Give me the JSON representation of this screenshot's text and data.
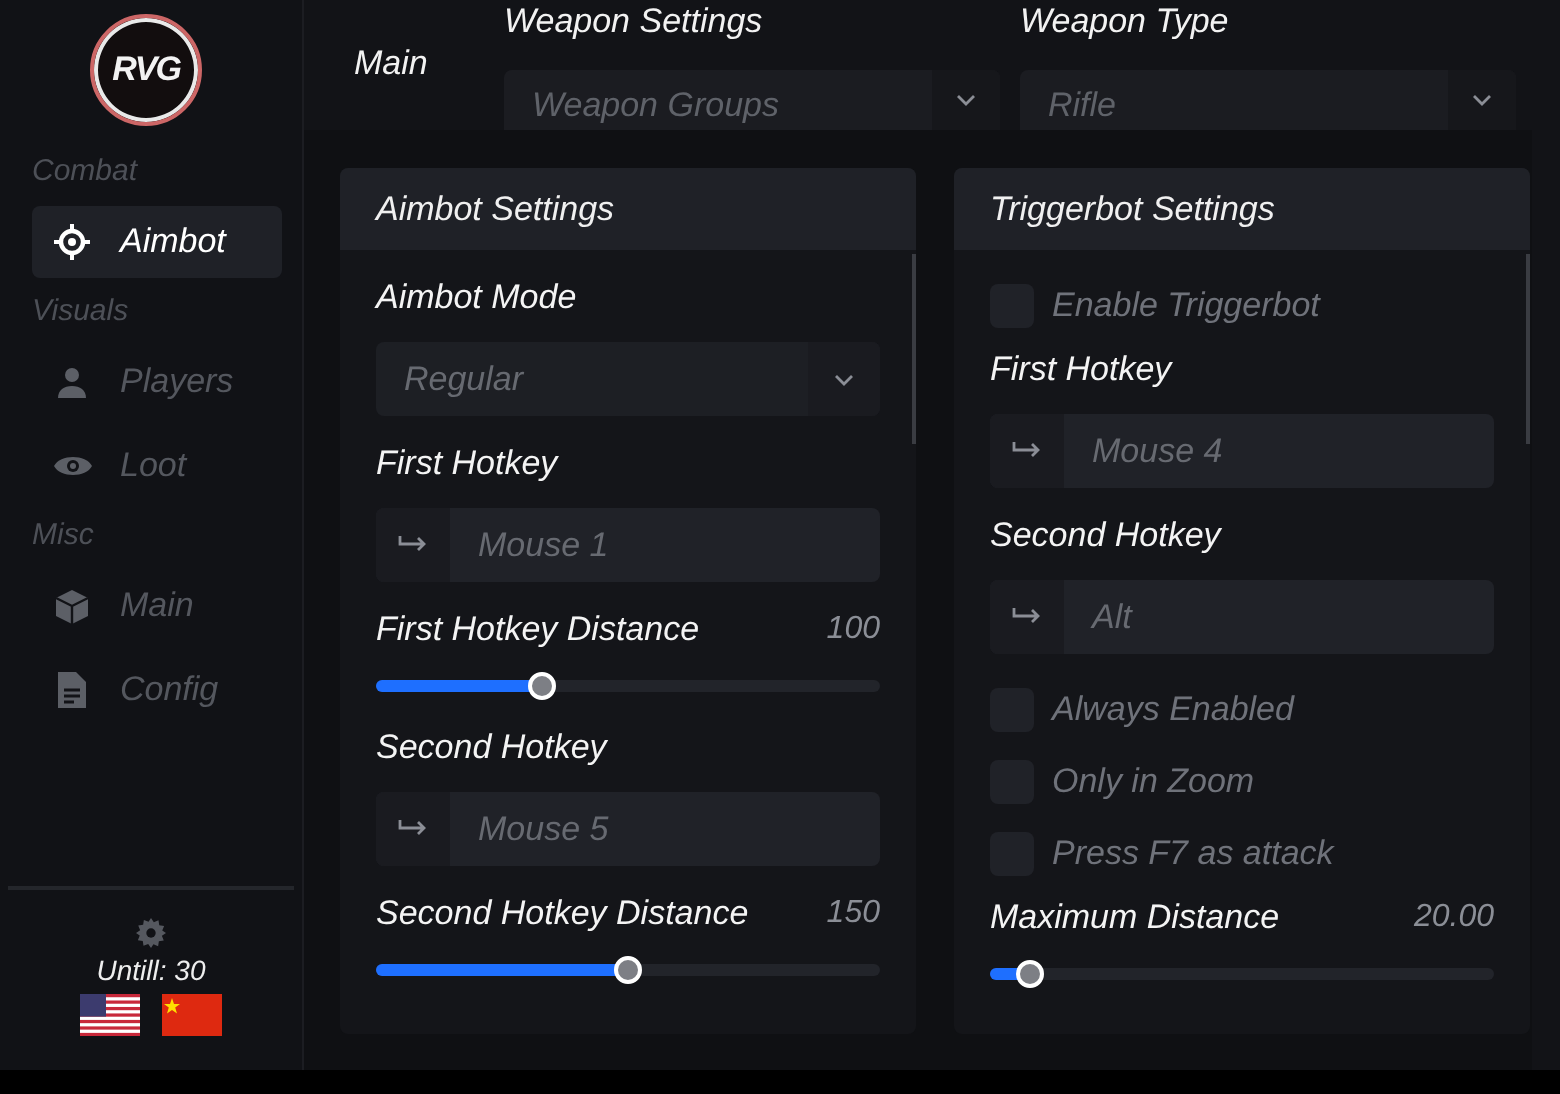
{
  "logo": {
    "text": "RVG"
  },
  "sidebar": {
    "sections": [
      {
        "title": "Combat",
        "items": [
          {
            "label": "Aimbot",
            "kind": "crosshair",
            "selected": true
          }
        ]
      },
      {
        "title": "Visuals",
        "items": [
          {
            "label": "Players",
            "kind": "person",
            "selected": false
          },
          {
            "label": "Loot",
            "kind": "eye",
            "selected": false
          }
        ]
      },
      {
        "title": "Misc",
        "items": [
          {
            "label": "Main",
            "kind": "cube",
            "selected": false
          },
          {
            "label": "Config",
            "kind": "file",
            "selected": false
          }
        ]
      }
    ],
    "footer": {
      "expiry": "Untill: 30",
      "flags": [
        {
          "kind": "us"
        },
        {
          "kind": "cn"
        }
      ]
    }
  },
  "header": {
    "tab": "Main",
    "dropdowns": [
      {
        "label": "Weapon Settings",
        "value": "Weapon Groups"
      },
      {
        "label": "Weapon Type",
        "value": "Rifle"
      }
    ]
  },
  "panels": [
    {
      "title": "Aimbot Settings",
      "controls": [
        {
          "kind": "select",
          "label": "Aimbot Mode",
          "value": "Regular"
        },
        {
          "kind": "hotkey",
          "label": "First Hotkey",
          "value": "Mouse 1"
        },
        {
          "kind": "slider",
          "label": "First Hotkey Distance",
          "reading": "100",
          "level": 0.33
        },
        {
          "kind": "hotkey",
          "label": "Second Hotkey",
          "value": "Mouse 5"
        },
        {
          "kind": "slider",
          "label": "Second Hotkey Distance",
          "reading": "150",
          "level": 0.5
        }
      ]
    },
    {
      "title": "Triggerbot Settings",
      "controls": [
        {
          "kind": "checkbox",
          "label": "Enable Triggerbot",
          "checked": false
        },
        {
          "kind": "hotkey",
          "label": "First Hotkey",
          "value": "Mouse 4"
        },
        {
          "kind": "hotkey",
          "label": "Second Hotkey",
          "value": "Alt"
        },
        {
          "kind": "checkbox",
          "label": "Always Enabled",
          "checked": false
        },
        {
          "kind": "checkbox",
          "label": "Only in Zoom",
          "checked": false
        },
        {
          "kind": "checkbox",
          "label": "Press F7 as attack",
          "checked": false
        },
        {
          "kind": "slider",
          "label": "Maximum Distance",
          "reading": "20.00",
          "level": 0.08
        }
      ]
    }
  ]
}
